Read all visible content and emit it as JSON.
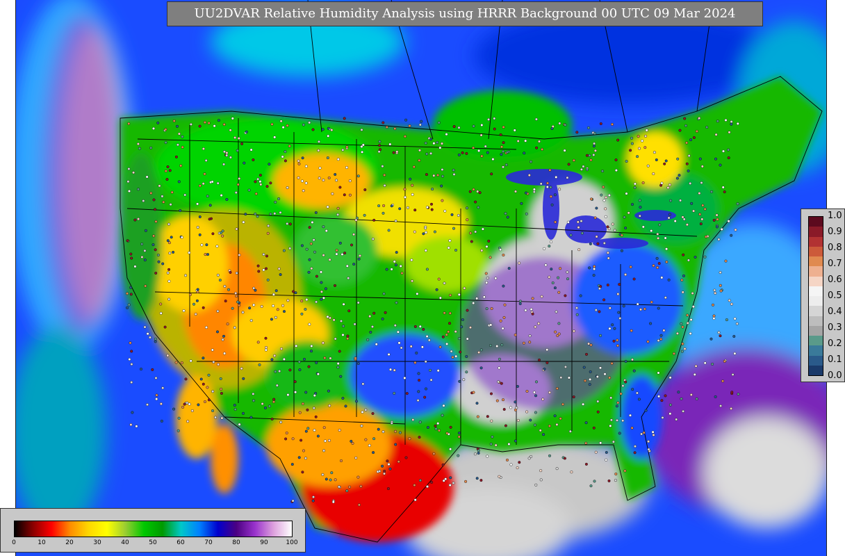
{
  "map": {
    "title": "UU2DVAR Relative Humidity Analysis using HRRR Background 00 UTC 09 Mar 2024"
  },
  "rh_colorbar": {
    "ticks": [
      "0",
      "10",
      "20",
      "30",
      "40",
      "50",
      "60",
      "70",
      "80",
      "90",
      "100"
    ],
    "range": [
      0,
      100
    ],
    "colors": [
      "#000000",
      "#8b0000",
      "#ff0000",
      "#ff8c00",
      "#ffd700",
      "#ffff00",
      "#9acd32",
      "#00c800",
      "#009a00",
      "#00c8c8",
      "#0080ff",
      "#0000cd",
      "#4b0082",
      "#9932cc",
      "#dda0dd",
      "#ffffff"
    ]
  },
  "obs_colorbar": {
    "ticks": [
      "1.0",
      "0.9",
      "0.8",
      "0.7",
      "0.6",
      "0.5",
      "0.4",
      "0.3",
      "0.2",
      "0.1",
      "0.0"
    ],
    "range": [
      0.0,
      1.0
    ],
    "colors": [
      "#5c0a1e",
      "#8a1a28",
      "#b23232",
      "#cc5a3a",
      "#e08a50",
      "#eeb090",
      "#f5d5c5",
      "#f5f5f5",
      "#ededed",
      "#d5d5d5",
      "#bdbdbd",
      "#a5a5a5",
      "#5a9a8a",
      "#3a7a9a",
      "#2a5a8a",
      "#1a3a6a"
    ]
  }
}
